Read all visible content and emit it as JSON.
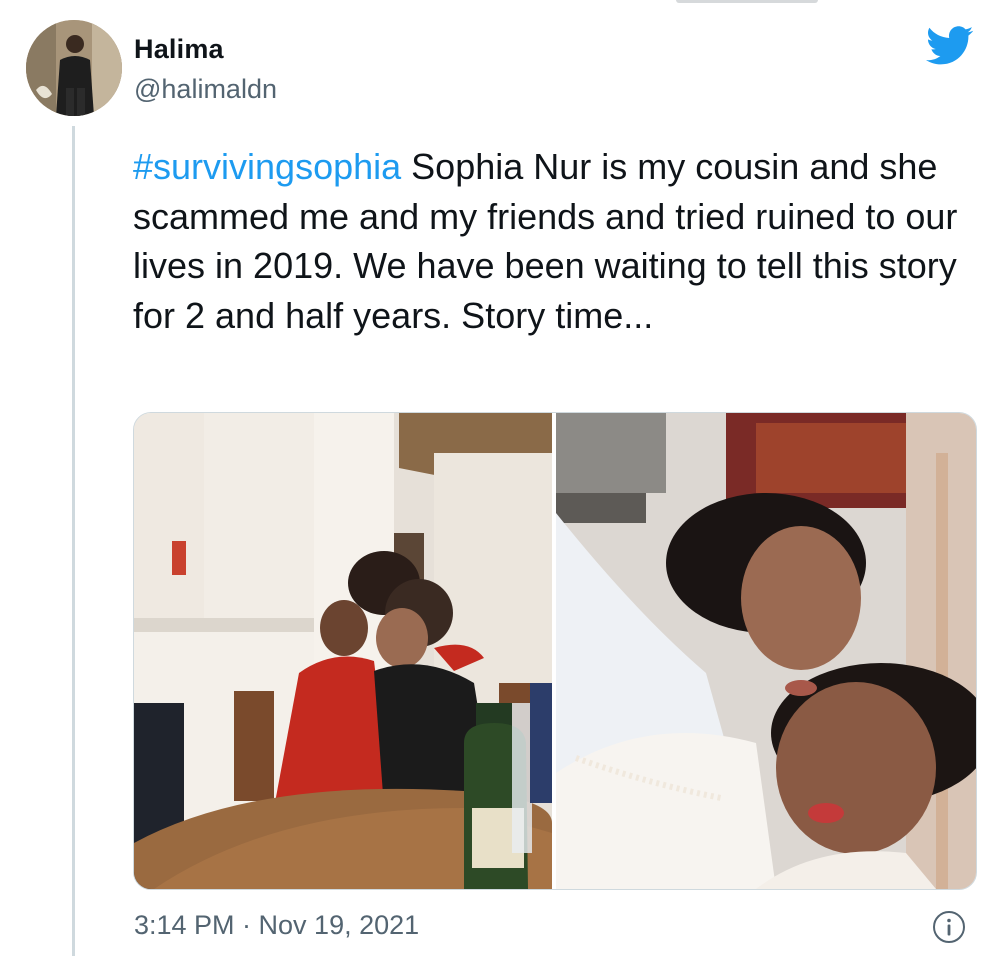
{
  "user": {
    "name": "Halima",
    "handle": "@halimaldn"
  },
  "tweet": {
    "hashtag": "#survivingsophia",
    "body": " Sophia Nur is my cousin and she scammed me and my friends and tried ruined to our lives in 2019. We have been waiting to tell this story for 2 and half years. Story time...",
    "timestamp": "3:14 PM · Nov 19, 2021"
  },
  "icons": {
    "brand": "twitter-bird-icon",
    "info": "info-icon"
  },
  "colors": {
    "link": "#1d9bf0",
    "secondary_text": "#536471",
    "brand": "#1d9bf0",
    "divider": "#cfd9de"
  }
}
